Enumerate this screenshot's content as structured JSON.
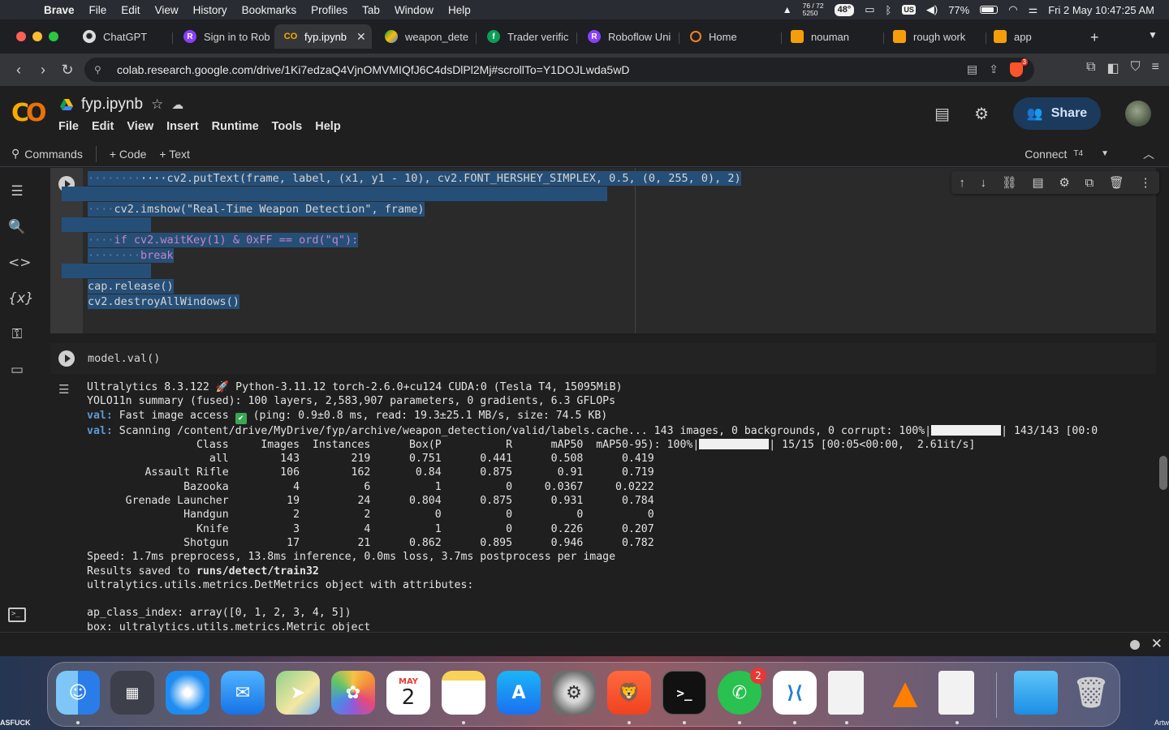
{
  "menubar": {
    "app": "Brave",
    "items": [
      "File",
      "Edit",
      "View",
      "History",
      "Bookmarks",
      "Profiles",
      "Tab",
      "Window",
      "Help"
    ],
    "temp_top": "76 / 72",
    "temp_bottom": "5250",
    "weather": "48°",
    "keyboard": "US",
    "battery": "77%",
    "datetime": "Fri 2 May  10:47:25 AM"
  },
  "tabs": [
    {
      "label": "ChatGPT"
    },
    {
      "label": "Sign in to Rob"
    },
    {
      "label": "fyp.ipynb"
    },
    {
      "label": "weapon_dete"
    },
    {
      "label": "Trader verific"
    },
    {
      "label": "Roboflow Uni"
    },
    {
      "label": "Home"
    },
    {
      "label": "nouman"
    },
    {
      "label": "rough work"
    },
    {
      "label": "app"
    }
  ],
  "address": {
    "url": "colab.research.google.com/drive/1Ki7edzaQ4VjnOMVMIQfJ6C4dsDlPl2Mj#scrollTo=Y1DOJLwda5wD",
    "shield_count": "3"
  },
  "colab": {
    "notebook_name": "fyp.ipynb",
    "menu": [
      "File",
      "Edit",
      "View",
      "Insert",
      "Runtime",
      "Tools",
      "Help"
    ],
    "share_label": "Share",
    "toolbar": {
      "commands": "Commands",
      "code": "+ Code",
      "text": "+ Text",
      "connect": "Connect",
      "runtime": "T4"
    }
  },
  "cell1": {
    "lines": [
      {
        "indent": "········",
        "text": "cv2.putText(frame, label, (x1, y1 - 10), cv2.FONT_HERSHEY_SIMPLEX, 0.5, (0, 255, 0), 2)"
      },
      {
        "indent": "",
        "text": ""
      },
      {
        "indent": "····",
        "text": "cv2.imshow(\"Real-Time Weapon Detection\", frame)"
      },
      {
        "indent": "",
        "text": ""
      },
      {
        "indent": "····",
        "text": "if cv2.waitKey(1) & 0xFF == ord(\"q\"):"
      },
      {
        "indent": "········",
        "text": "break"
      },
      {
        "indent": "",
        "text": ""
      },
      {
        "indent": "",
        "text": "cap.release()"
      },
      {
        "indent": "",
        "text": "cv2.destroyAllWindows()"
      }
    ]
  },
  "cell2": {
    "code": "model.val()"
  },
  "output": {
    "line1": "Ultralytics 8.3.122 🚀 Python-3.11.12 torch-2.6.0+cu124 CUDA:0 (Tesla T4, 15095MiB)",
    "line2": "YOLO11n summary (fused): 100 layers, 2,583,907 parameters, 0 gradients, 6.3 GFLOPs",
    "line3_label": "val:",
    "line3_a": " Fast image access ",
    "line3_b": " (ping: 0.9±0.8 ms, read: 19.3±25.1 MB/s, size: 74.5 KB)",
    "line4_label": "val:",
    "line4_a": " Scanning /content/drive/MyDrive/fyp/archive/weapon_detection/valid/labels.cache... 143 images, 0 backgrounds, 0 corrupt: 100%|",
    "line4_b": "| 143/143 [00:0",
    "header_a": "                 Class     Images  Instances      Box(P          R      mAP50  mAP50-95): 100%|",
    "header_b": "| 15/15 [00:05<00:00,  2.61it/s]",
    "rows": [
      "                   all        143        219      0.751      0.441      0.508      0.419",
      "         Assault Rifle        106        162       0.84      0.875       0.91      0.719",
      "               Bazooka          4          6          1          0     0.0367     0.0222",
      "      Grenade Launcher         19         24      0.804      0.875      0.931      0.784",
      "               Handgun          2          2          0          0          0          0",
      "                 Knife          3          4          1          0      0.226      0.207",
      "               Shotgun         17         21      0.862      0.895      0.946      0.782"
    ],
    "speed": "Speed: 1.7ms preprocess, 13.8ms inference, 0.0ms loss, 3.7ms postprocess per image",
    "saved_prefix": "Results saved to ",
    "saved_path": "runs/detect/train32",
    "metrics": "ultralytics.utils.metrics.DetMetrics object with attributes:",
    "ap_index": "ap_class_index: array([0, 1, 2, 3, 4, 5])",
    "box": "box: ultralytics.utils.metrics.Metric object"
  },
  "dock": {
    "calendar_month": "MAY",
    "calendar_day": "2",
    "whatsapp_badge": "2"
  },
  "desktop": {
    "left_text": "ASFUCK",
    "right_text": "Artw"
  }
}
